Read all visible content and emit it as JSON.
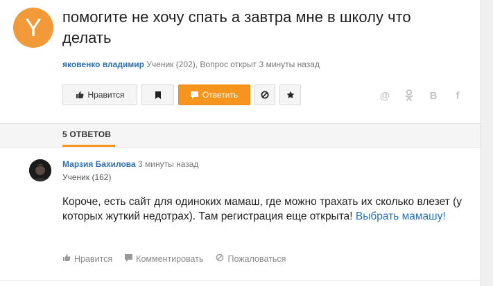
{
  "question": {
    "avatar_letter": "Y",
    "avatar_color": "#f29a39",
    "title": "помогите не хочу спать а завтра мне в школу что делать",
    "author": "яковенко владимир",
    "meta": " Ученик (202), Вопрос открыт 3 минуты назад"
  },
  "actions": {
    "like_label": "Нравится",
    "answer_label": "Ответить",
    "accent_color": "#f7941d"
  },
  "social": [
    "at-icon",
    "odnoklassniki-icon",
    "vk-icon",
    "facebook-icon"
  ],
  "social_labels": {
    "at": "@",
    "ok": "ℵ",
    "vk": "B",
    "fb": "f"
  },
  "answers": {
    "header": "5 ОТВЕТОВ",
    "items": [
      {
        "author": "Марзия Бахилова",
        "time": " 3 минуты назад",
        "rank": "Ученик (162)",
        "text": "Короче, есть сайт для одиноких мамаш, где можно трахать их сколько влезет (у которых жуткий недотрах). Там регистрация еще открыта! ",
        "link": "Выбрать мамашу!",
        "like_label": "Нравится",
        "comment_label": "Комментировать",
        "report_label": "Пожаловаться"
      }
    ]
  }
}
